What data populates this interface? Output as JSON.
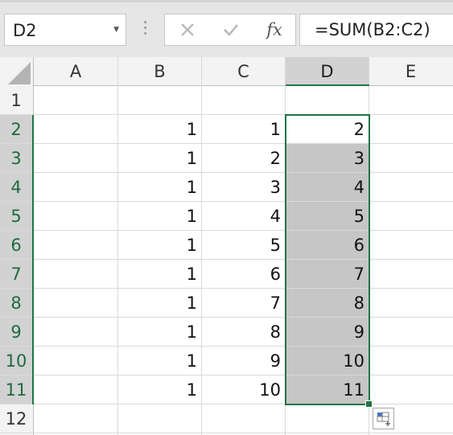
{
  "name_box": {
    "value": "D2"
  },
  "formula_bar": {
    "cancel_icon": "close-icon",
    "enter_icon": "checkmark-icon",
    "fx_label": "fx",
    "formula": "=SUM(B2:C2)"
  },
  "columns": [
    {
      "label": "A",
      "selected": false
    },
    {
      "label": "B",
      "selected": false
    },
    {
      "label": "C",
      "selected": false
    },
    {
      "label": "D",
      "selected": true
    },
    {
      "label": "E",
      "selected": false
    }
  ],
  "rows": [
    {
      "label": "1",
      "selected": false,
      "cells": [
        "",
        "",
        "",
        "",
        ""
      ]
    },
    {
      "label": "2",
      "selected": true,
      "cells": [
        "",
        "1",
        "1",
        "2",
        ""
      ]
    },
    {
      "label": "3",
      "selected": true,
      "cells": [
        "",
        "1",
        "2",
        "3",
        ""
      ]
    },
    {
      "label": "4",
      "selected": true,
      "cells": [
        "",
        "1",
        "3",
        "4",
        ""
      ]
    },
    {
      "label": "5",
      "selected": true,
      "cells": [
        "",
        "1",
        "4",
        "5",
        ""
      ]
    },
    {
      "label": "6",
      "selected": true,
      "cells": [
        "",
        "1",
        "5",
        "6",
        ""
      ]
    },
    {
      "label": "7",
      "selected": true,
      "cells": [
        "",
        "1",
        "6",
        "7",
        ""
      ]
    },
    {
      "label": "8",
      "selected": true,
      "cells": [
        "",
        "1",
        "7",
        "8",
        ""
      ]
    },
    {
      "label": "9",
      "selected": true,
      "cells": [
        "",
        "1",
        "8",
        "9",
        ""
      ]
    },
    {
      "label": "10",
      "selected": true,
      "cells": [
        "",
        "1",
        "9",
        "10",
        ""
      ]
    },
    {
      "label": "11",
      "selected": true,
      "cells": [
        "",
        "1",
        "10",
        "11",
        ""
      ]
    },
    {
      "label": "12",
      "selected": false,
      "cells": [
        "",
        "",
        "",
        "",
        ""
      ]
    }
  ],
  "selection": {
    "range": "D2:D11",
    "active_cell": "D2"
  },
  "colors": {
    "accent": "#217346",
    "selection_fill": "#c6c6c6",
    "header_bg": "#f3f3f3"
  },
  "quick_analysis": {
    "icon": "quick-analysis-icon"
  }
}
